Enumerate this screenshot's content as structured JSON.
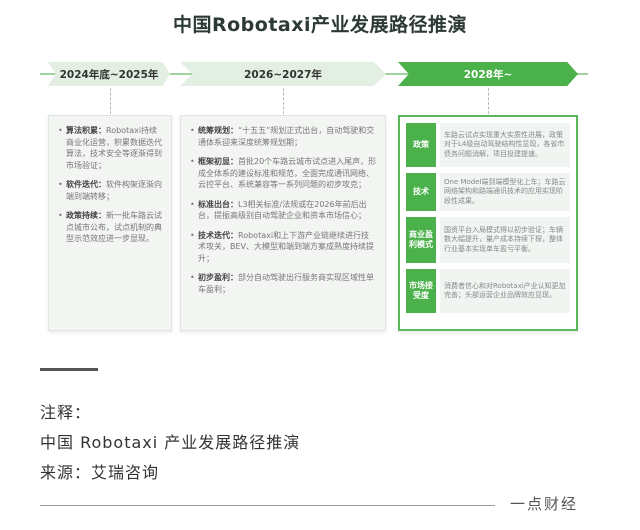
{
  "title": "中国Robotaxi产业发展路径推演",
  "phases": [
    {
      "label": "2024年底~2025年",
      "items": [
        {
          "label": "算法积累：",
          "text": "Robotaxi持续商业化运营，积累数据迭代算法，技术安全等逐渐得到市场验证；"
        },
        {
          "label": "软件迭代：",
          "text": "软件构架逐渐向端到端转移；"
        },
        {
          "label": "政策持续：",
          "text": "新一批车路云试点城市公布，试点机制的典型示范效应进一步显现。"
        }
      ]
    },
    {
      "label": "2026~2027年",
      "items": [
        {
          "label": "统筹规划：",
          "text": "“十五五”规划正式出台，自动驾驶和交通体系迎来深度统筹规划期；"
        },
        {
          "label": "框架初显：",
          "text": "首批20个车路云城市试点进入尾声，形成全体系的建设标准和规范，全面完成通讯网络、云控平台、系统兼容等一系列问题的初步攻克；"
        },
        {
          "label": "标准出台：",
          "text": "L3相关标准/法规或在2026年前后出台，提振高级别自动驾驶企业和资本市场信心；"
        },
        {
          "label": "技术迭代：",
          "text": "Robotaxi和上下游产业链继续进行技术攻关，BEV、大模型和端到端方案成熟度持续提升；"
        },
        {
          "label": "初步盈利：",
          "text": "部分自动驾驶出行服务商实现区域性单车盈利；"
        }
      ]
    },
    {
      "label": "2028年~",
      "rows": [
        {
          "label": "政策",
          "text": "车路云试点实现重大实质性进展，政策对于L4级自动驾驶结构性显现，各省市债务问题消解，项目投建提速。"
        },
        {
          "label": "技术",
          "text": "One Model端到端模型化上车；车路云网络架构和路端通讯技术的应用实现阶段性成果。"
        },
        {
          "label": "商业盈利模式",
          "text": "国资平台入局模式得以初步验证；车辆数大幅提升，量产成本持续下探，整体行业基本实现单车盈亏平衡。"
        },
        {
          "label": "市场接受度",
          "text": "消费者信心和对Robotaxi产业认知更加完善；头部运营企业品牌效应显现。"
        }
      ]
    }
  ],
  "notes": {
    "line1": "注释：",
    "line2": "中国 Robotaxi 产业发展路径推演",
    "line3": "来源：艾瑞咨询"
  },
  "brand": "一点财经",
  "colors": {
    "accent": "#4bb14b",
    "accent_light": "#e2efe2"
  }
}
